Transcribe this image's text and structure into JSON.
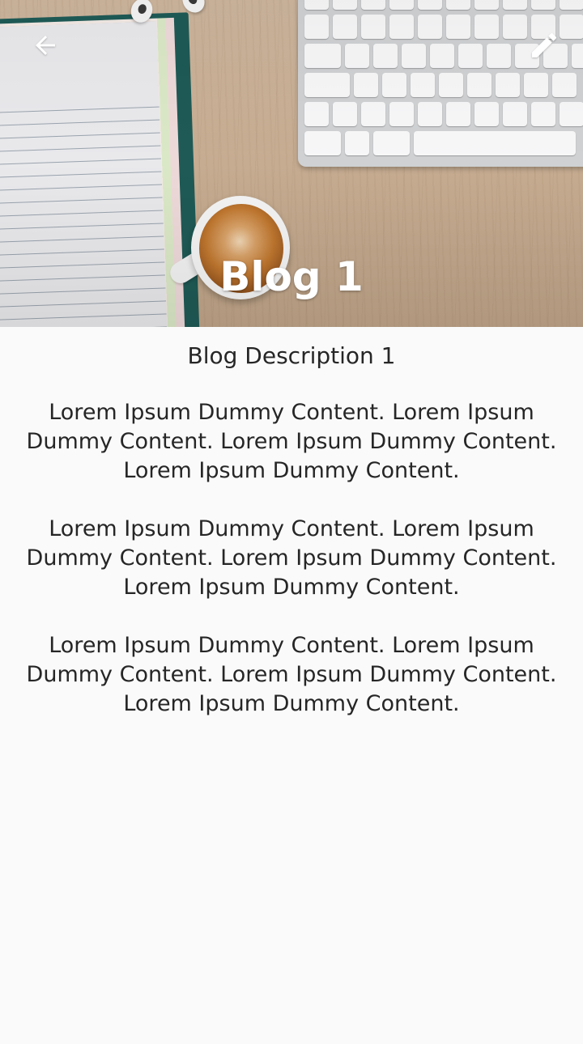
{
  "header": {
    "title": "Blog 1",
    "back_icon": "arrow-back-icon",
    "edit_icon": "edit-pencil-icon",
    "icon_color": "#ffffff"
  },
  "blog": {
    "description": "Blog Description 1",
    "paragraphs": [
      "Lorem Ipsum Dummy Content. Lorem Ipsum Dummy Content. Lorem Ipsum Dummy Content. Lorem Ipsum Dummy Content.",
      "Lorem Ipsum Dummy Content. Lorem Ipsum Dummy Content. Lorem Ipsum Dummy Content. Lorem Ipsum Dummy Content.",
      "Lorem Ipsum Dummy Content. Lorem Ipsum Dummy Content. Lorem Ipsum Dummy Content. Lorem Ipsum Dummy Content."
    ]
  },
  "colors": {
    "background": "#fafafa",
    "text": "#262626"
  }
}
